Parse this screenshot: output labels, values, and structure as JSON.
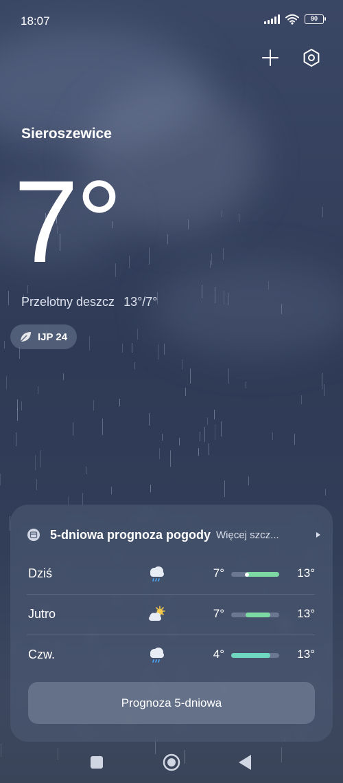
{
  "status_bar": {
    "time": "18:07",
    "battery": "90"
  },
  "header": {
    "city": "Sieroszewice",
    "temperature": "7°",
    "condition": "Przelotny deszcz",
    "range": "13°/7°",
    "aqi_label": "IJP 24"
  },
  "forecast": {
    "title": "5-dniowa prognoza pogody",
    "more_label": "Więcej szcz...",
    "days": [
      {
        "label": "Dziś",
        "icon": "rain-cloud-icon",
        "low": "7°",
        "high": "13°",
        "range_fraction": [
          0.3,
          1.0
        ],
        "now_fraction": 0.33,
        "bar_color": "#7ed8a4"
      },
      {
        "label": "Jutro",
        "icon": "partly-sunny-icon",
        "low": "7°",
        "high": "13°",
        "range_fraction": [
          0.3,
          0.82
        ],
        "bar_color": "#7ed8a4"
      },
      {
        "label": "Czw.",
        "icon": "rain-cloud-icon",
        "low": "4°",
        "high": "13°",
        "range_fraction": [
          0.0,
          0.82
        ],
        "bar_color": "#6fd6c0"
      }
    ],
    "button_label": "Prognoza 5-dniowa"
  },
  "colors": {
    "accent_green": "#7ed8a4",
    "accent_teal": "#6fd6c0",
    "sun_yellow": "#f2c94c",
    "rain_blue": "#4aa3f0"
  }
}
